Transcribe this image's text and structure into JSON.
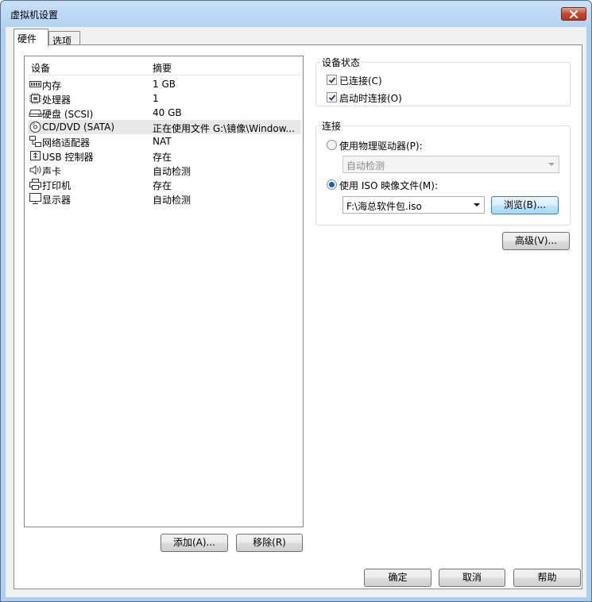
{
  "window": {
    "title": "虚拟机设置"
  },
  "tabs": [
    {
      "label": "硬件"
    },
    {
      "label": "选项"
    }
  ],
  "device_list": {
    "columns": {
      "device": "设备",
      "summary": "摘要"
    },
    "rows": [
      {
        "icon": "memory-icon",
        "name": "内存",
        "summary": "1 GB"
      },
      {
        "icon": "processor-icon",
        "name": "处理器",
        "summary": "1"
      },
      {
        "icon": "hard-disk-icon",
        "name": "硬盘 (SCSI)",
        "summary": "40 GB"
      },
      {
        "icon": "cd-dvd-icon",
        "name": "CD/DVD (SATA)",
        "summary": "正在使用文件 G:\\镜像\\Window..."
      },
      {
        "icon": "network-adapter-icon",
        "name": "网络适配器",
        "summary": "NAT"
      },
      {
        "icon": "usb-icon",
        "name": "USB 控制器",
        "summary": "存在"
      },
      {
        "icon": "sound-card-icon",
        "name": "声卡",
        "summary": "自动检测"
      },
      {
        "icon": "printer-icon",
        "name": "打印机",
        "summary": "存在"
      },
      {
        "icon": "display-icon",
        "name": "显示器",
        "summary": "自动检测"
      }
    ],
    "add_label": "添加(A)...",
    "remove_label": "移除(R)"
  },
  "device_status": {
    "title": "设备状态",
    "connected_label": "已连接(C)",
    "connected": true,
    "connect_at_power_on_label": "启动时连接(O)",
    "connect_at_power_on": true
  },
  "connection": {
    "title": "连接",
    "physical_drive_label": "使用物理驱动器(P):",
    "physical_drive_value": "自动检测",
    "iso_label": "使用 ISO 映像文件(M):",
    "iso_value": "F:\\海总软件包.iso",
    "selected": "iso",
    "browse_label": "浏览(B)..."
  },
  "advanced_label": "高级(V)...",
  "footer": {
    "ok_label": "确定",
    "cancel_label": "取消",
    "help_label": "帮助"
  }
}
